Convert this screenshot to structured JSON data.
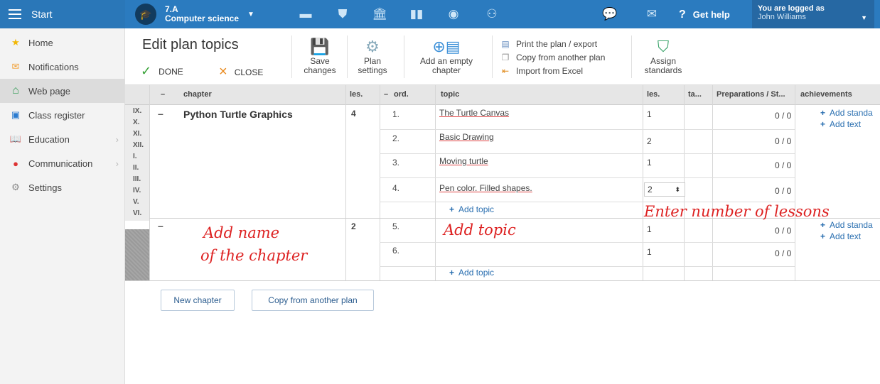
{
  "topbar": {
    "start_label": "Start",
    "class_line1": "7.A",
    "class_line2": "Computer science",
    "help_label": "Get help",
    "logged_as": "You are logged as",
    "user_name": "John Williams"
  },
  "sidebar": {
    "items": [
      {
        "label": "Home",
        "icon": "star-icon"
      },
      {
        "label": "Notifications",
        "icon": "envelope-icon"
      },
      {
        "label": "Web page",
        "icon": "house-icon"
      },
      {
        "label": "Class register",
        "icon": "register-icon"
      },
      {
        "label": "Education",
        "icon": "book-icon"
      },
      {
        "label": "Communication",
        "icon": "chat-icon"
      },
      {
        "label": "Settings",
        "icon": "gear-icon"
      }
    ]
  },
  "toolbar": {
    "title": "Edit plan topics",
    "done": "DONE",
    "close": "CLOSE",
    "save_l1": "Save",
    "save_l2": "changes",
    "plan_l1": "Plan",
    "plan_l2": "settings",
    "addch_l1": "Add an empty",
    "addch_l2": "chapter",
    "print": "Print the plan / export",
    "copy": "Copy from another plan",
    "import": "Import from Excel",
    "assign_l1": "Assign",
    "assign_l2": "standards"
  },
  "table": {
    "headers": {
      "chapter": "chapter",
      "les": "les.",
      "ord": "ord.",
      "topic": "topic",
      "les2": "les.",
      "ta": "ta...",
      "prep": "Preparations / St...",
      "ach": "achievements"
    },
    "months": [
      "IX.",
      "X.",
      "XI.",
      "XII.",
      "I.",
      "II.",
      "III.",
      "IV.",
      "V.",
      "VI."
    ],
    "chapter1": {
      "name": "Python Turtle Graphics",
      "les": "4"
    },
    "chapter2": {
      "les": "2"
    },
    "rows": [
      {
        "ord": "1.",
        "topic": "The Turtle Canvas",
        "les": "1",
        "prep": "0 / 0"
      },
      {
        "ord": "2.",
        "topic": "Basic Drawing",
        "les": "2",
        "prep": "0 / 0"
      },
      {
        "ord": "3.",
        "topic": "Moving turtle",
        "les": "1",
        "prep": "0 / 0"
      },
      {
        "ord": "4.",
        "topic": "Pen color. Filled shapes.",
        "les": "2",
        "prep": "0 / 0"
      },
      {
        "ord": "5.",
        "topic": "",
        "les": "1",
        "prep": "0 / 0"
      },
      {
        "ord": "6.",
        "topic": "",
        "les": "1",
        "prep": "0 / 0"
      }
    ],
    "add_topic": "Add topic",
    "add_standard": "Add standa",
    "add_text": "Add text"
  },
  "annotations": {
    "enter_lessons": "Enter number of lessons",
    "add_topic": "Add topic",
    "add_name_1": "Add name",
    "add_name_2": "of the chapter"
  },
  "bottom": {
    "new_chapter": "New chapter",
    "copy_plan": "Copy from another plan"
  },
  "colors": {
    "topbar": "#2b7bbf",
    "annotation": "#dd2222",
    "link": "#2a6fb0"
  }
}
